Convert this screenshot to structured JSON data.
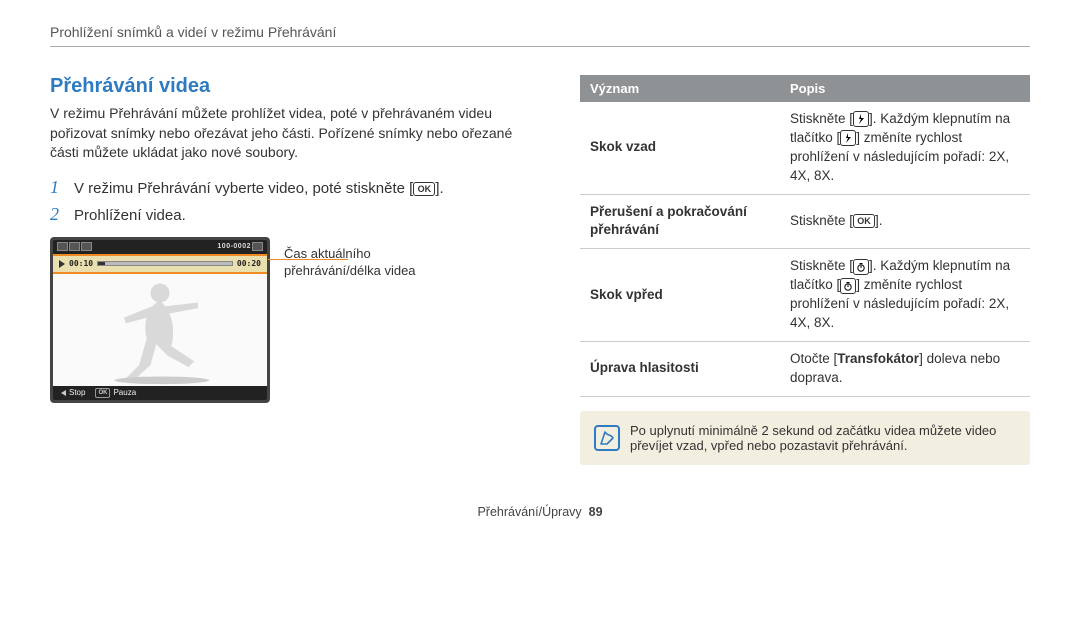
{
  "breadcrumb": "Prohlížení snímků a videí v režimu Přehrávání",
  "left": {
    "section_title": "Přehrávání videa",
    "intro": "V režimu Přehrávání můžete prohlížet videa, poté v přehrávaném videu pořizovat snímky nebo ořezávat jeho části. Pořízené snímky nebo ořezané části můžete ukládat jako nové soubory.",
    "step1_num": "1",
    "step1_text": "V režimu Přehrávání vyberte video, poté stiskněte [",
    "step1_suffix": "].",
    "step2_num": "2",
    "step2_text": "Prohlížení videa.",
    "shot": {
      "top_counter": "100-0002",
      "t_cur": "00:10",
      "t_total": "00:20",
      "stop": "Stop",
      "pause": "Pauza",
      "ok_label": "OK"
    },
    "caption_line1": "Čas aktuálního",
    "caption_line2": "přehrávání/délka videa"
  },
  "right": {
    "th1": "Význam",
    "th2": "Popis",
    "rows": {
      "r1_term": "Skok vzad",
      "r1_desc_a": "Stiskněte [",
      "r1_desc_b": "]. Každým klepnutím na tlačítko [",
      "r1_desc_c": "] změníte rychlost prohlížení v následujícím pořadí: 2X, 4X, 8X.",
      "r2_term": "Přerušení a pokračování přehrávání",
      "r2_desc_a": "Stiskněte [",
      "r2_desc_b": "].",
      "r3_term": "Skok vpřed",
      "r3_desc_a": "Stiskněte [",
      "r3_desc_b": "]. Každým klepnutím na tlačítko [",
      "r3_desc_c": "] změníte rychlost prohlížení v následujícím pořadí: 2X, 4X, 8X.",
      "r4_term": "Úprava hlasitosti",
      "r4_desc_a": "Otočte [",
      "r4_desc_bold": "Transfokátor",
      "r4_desc_b": "] doleva nebo doprava."
    },
    "note": "Po uplynutí minimálně 2 sekund od začátku videa můžete video převíjet vzad, vpřed nebo pozastavit přehrávání."
  },
  "ok_label": "OK",
  "footer": {
    "section": "Přehrávání/Úpravy",
    "page": "89"
  },
  "chart_data": {
    "type": "table",
    "title": "Přehrávání videa — ovládání",
    "columns": [
      "Význam",
      "Popis"
    ],
    "rows": [
      [
        "Skok vzad",
        "Stiskněte [⚡]. Každým klepnutím na tlačítko [⚡] změníte rychlost prohlížení v následujícím pořadí: 2X, 4X, 8X."
      ],
      [
        "Přerušení a pokračování přehrávání",
        "Stiskněte [OK]."
      ],
      [
        "Skok vpřed",
        "Stiskněte [timer]. Každým klepnutím na tlačítko [timer] změníte rychlost prohlížení v následujícím pořadí: 2X, 4X, 8X."
      ],
      [
        "Úprava hlasitosti",
        "Otočte [Transfokátor] doleva nebo doprava."
      ]
    ]
  }
}
